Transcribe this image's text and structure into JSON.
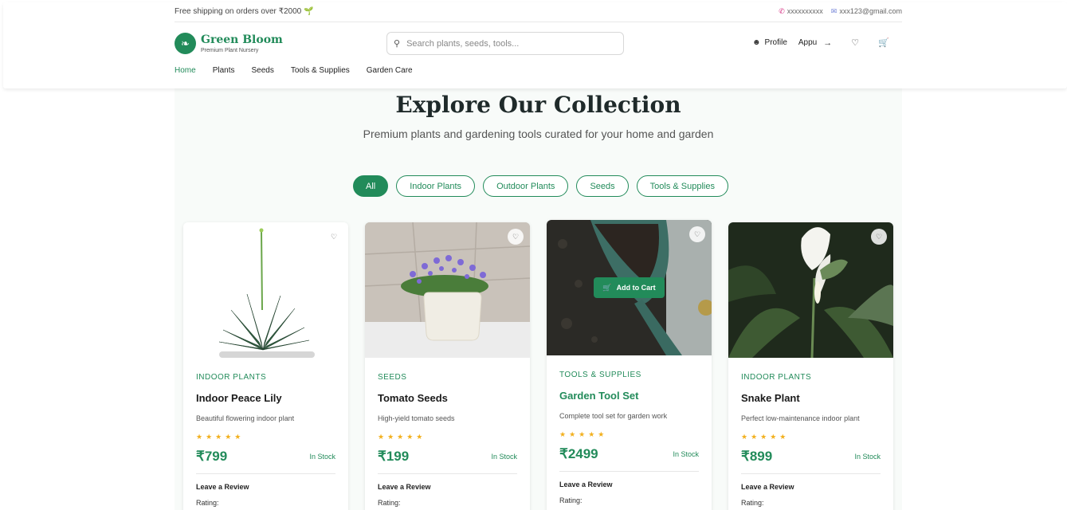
{
  "topbar": {
    "promo": "Free shipping on orders over ₹2000 🌱",
    "phone": "xxxxxxxxxx",
    "email": "xxx123@gmail.com"
  },
  "brand": {
    "name": "Green Bloom",
    "tagline": "Premium Plant Nursery"
  },
  "search": {
    "placeholder": "Search plants, seeds, tools..."
  },
  "actions": {
    "profile": "Profile",
    "user": "Appu"
  },
  "nav": [
    "Home",
    "Plants",
    "Seeds",
    "Tools & Supplies",
    "Garden Care"
  ],
  "hero": {
    "title": "Explore Our Collection",
    "subtitle": "Premium plants and gardening tools curated for your home and garden"
  },
  "filters": [
    "All",
    "Indoor Plants",
    "Outdoor Plants",
    "Seeds",
    "Tools & Supplies"
  ],
  "products": [
    {
      "category": "Indoor Plants",
      "name": "Indoor Peace Lily",
      "description": "Beautiful flowering indoor plant",
      "stars": "★★★★★",
      "price": "₹799",
      "stock": "In Stock",
      "review": "Leave a Review",
      "rating": "Rating:"
    },
    {
      "category": "Seeds",
      "name": "Tomato Seeds",
      "description": "High-yield tomato seeds",
      "stars": "★★★★★",
      "price": "₹199",
      "stock": "In Stock",
      "review": "Leave a Review",
      "rating": "Rating:"
    },
    {
      "category": "Tools & Supplies",
      "name": "Garden Tool Set",
      "description": "Complete tool set for garden work",
      "stars": "★★★★★",
      "price": "₹2499",
      "stock": "In Stock",
      "review": "Leave a Review",
      "rating": "Rating:",
      "cart_label": "Add to Cart"
    },
    {
      "category": "Indoor Plants",
      "name": "Snake Plant",
      "description": "Perfect low-maintenance indoor plant",
      "stars": "★★★★★",
      "price": "₹899",
      "stock": "In Stock",
      "review": "Leave a Review",
      "rating": "Rating:"
    }
  ],
  "colors": {
    "accent": "#228b5a",
    "star": "#f2b01e"
  }
}
